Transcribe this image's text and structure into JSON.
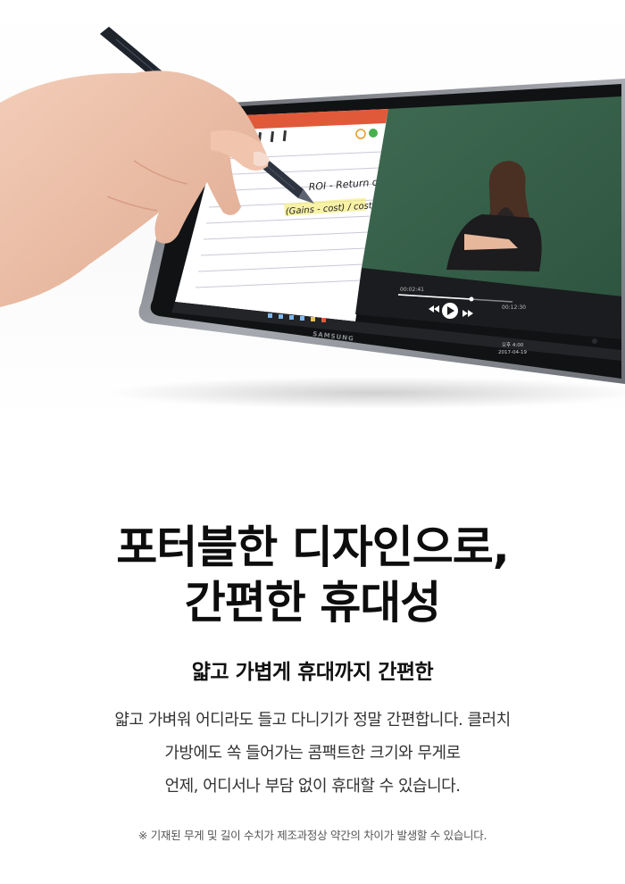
{
  "hero": {
    "note_line1": "ROI - Return on Investment",
    "note_line2": "(Gains - cost) / cost",
    "brand_logo": "SAMSUNG",
    "video_time_start": "00:02:41",
    "video_time_end": "00:12:30",
    "taskbar_clock": "오후 4:00",
    "taskbar_date": "2017-04-19"
  },
  "headline": {
    "line1": "포터블한 디자인으로,",
    "line2": "간편한 휴대성"
  },
  "subtitle": "얇고 가볍게 휴대까지 간편한",
  "body": {
    "line1": "얇고 가벼워 어디라도 들고 다니기가 정말 간편합니다. 클러치",
    "line2": "가방에도 쏙 들어가는 콤팩트한 크기와 무게로",
    "line3": "언제, 어디서나 부담 없이 휴대할 수 있습니다."
  },
  "disclaimer": "※ 기재된 무게 및 길이 수치가 제조과정상 약간의 차이가 발생할 수 있습니다."
}
